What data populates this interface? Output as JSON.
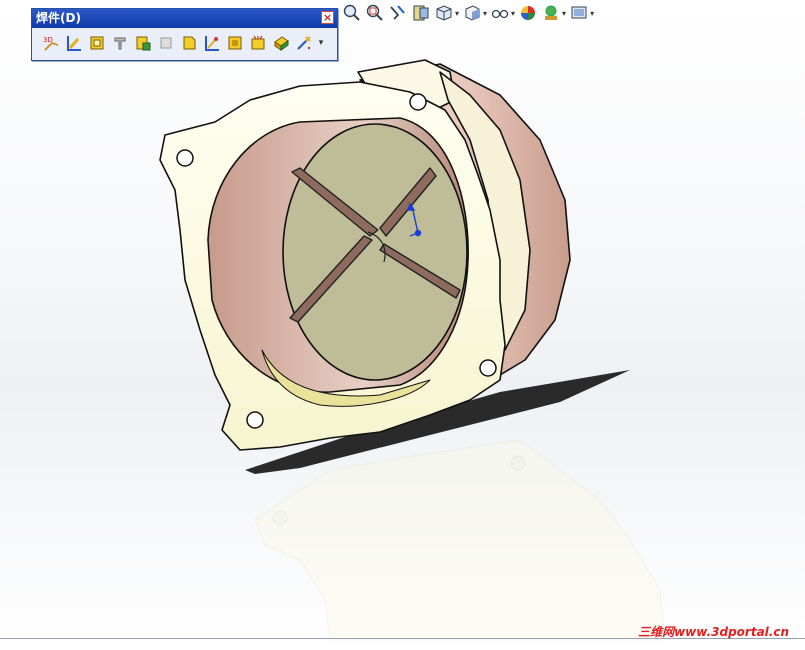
{
  "weldments_toolbar": {
    "title": "焊件(D)",
    "close_symbol": "×",
    "tools": [
      {
        "icon": "3d-sketch-icon"
      },
      {
        "icon": "structural-member-icon"
      },
      {
        "icon": "trim-extend-icon"
      },
      {
        "icon": "weldment-icon"
      },
      {
        "icon": "end-cap-icon"
      },
      {
        "icon": "gusset-icon"
      },
      {
        "icon": "fillet-bead-icon"
      },
      {
        "icon": "weld-bead-icon"
      },
      {
        "icon": "extruded-boss-icon"
      },
      {
        "icon": "extruded-cut-icon"
      },
      {
        "icon": "hole-wizard-icon"
      },
      {
        "icon": "chamfer-icon"
      },
      {
        "icon": "cut-list-icon"
      }
    ],
    "more_symbol": "▾"
  },
  "view_toolbar": {
    "items": [
      {
        "icon": "zoom-to-fit-icon",
        "caret": false
      },
      {
        "icon": "zoom-to-area-icon",
        "caret": false
      },
      {
        "icon": "previous-view-icon",
        "caret": false
      },
      {
        "icon": "section-view-icon",
        "caret": false
      },
      {
        "icon": "view-orientation-icon",
        "caret": true
      },
      {
        "icon": "display-style-icon",
        "caret": true
      },
      {
        "icon": "hide-show-items-icon",
        "caret": true
      },
      {
        "icon": "edit-appearance-icon",
        "caret": false
      },
      {
        "icon": "apply-scene-icon",
        "caret": true
      },
      {
        "icon": "view-settings-icon",
        "caret": true
      }
    ],
    "caret_symbol": "▾"
  },
  "model": {
    "part": "flanged-housing",
    "colors": {
      "face": "#fdfde8",
      "edge": "#111111",
      "inner": "#cfa79a",
      "base": "#b9b68f"
    }
  },
  "watermark": "三维网www.3dportal.cn"
}
